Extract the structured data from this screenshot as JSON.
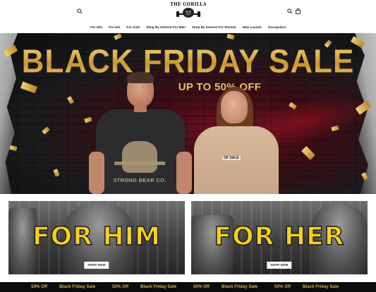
{
  "header": {
    "logo_text": "THE GORILLA",
    "left_icon": "search-icon",
    "right_icons": [
      "search-icon",
      "bag-icon"
    ]
  },
  "nav": {
    "items": [
      {
        "label": "For Him"
      },
      {
        "label": "For Her"
      },
      {
        "label": "For Kids"
      },
      {
        "label": "Shop By Interest For Men"
      },
      {
        "label": "Shop By Interest For Women"
      },
      {
        "label": "New Launch"
      },
      {
        "label": "Occupation"
      }
    ]
  },
  "hero": {
    "title": "BLACK FRIDAY SALE",
    "subtitle": "UP TO 50% OFF",
    "shirt_text": "STRONG BEAR CO.",
    "hoodie_text": "OF SALE"
  },
  "categories": [
    {
      "title": "FOR HIM",
      "button": "SHOP NOW"
    },
    {
      "title": "FOR HER",
      "button": "SHOP NOW"
    }
  ],
  "marquee": {
    "items": [
      "50% Off",
      "Black Friday Sale",
      "50% Off",
      "Black Friday Sale",
      "50% Off",
      "Black Friday Sale",
      "50% Off",
      "Black Friday Sale"
    ]
  },
  "colors": {
    "gold": "#d8b04a",
    "accent_yellow": "#f2d21b",
    "hero_red": "#6a1220"
  }
}
